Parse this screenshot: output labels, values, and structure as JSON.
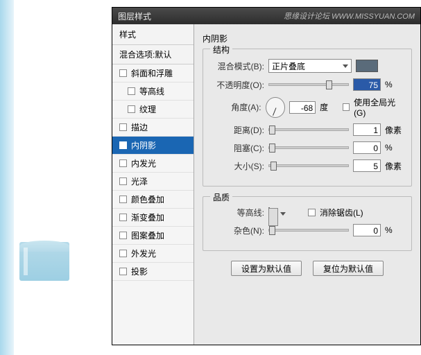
{
  "window": {
    "title": "图层样式",
    "watermark": "思缘设计论坛  WWW.MISSYUAN.COM"
  },
  "sidebar": {
    "header": "样式",
    "sub": "混合选项:默认",
    "items": [
      {
        "label": "斜面和浮雕",
        "indent": false
      },
      {
        "label": "等高线",
        "indent": true
      },
      {
        "label": "纹理",
        "indent": true
      },
      {
        "label": "描边",
        "indent": false
      },
      {
        "label": "内阴影",
        "indent": false,
        "selected": true
      },
      {
        "label": "内发光",
        "indent": false
      },
      {
        "label": "光泽",
        "indent": false
      },
      {
        "label": "颜色叠加",
        "indent": false
      },
      {
        "label": "渐变叠加",
        "indent": false
      },
      {
        "label": "图案叠加",
        "indent": false
      },
      {
        "label": "外发光",
        "indent": false
      },
      {
        "label": "投影",
        "indent": false
      }
    ]
  },
  "panel": {
    "title": "内阴影",
    "structure": {
      "legend": "结构",
      "blend_label": "混合模式(B):",
      "blend_value": "正片叠底",
      "color": "#5a6b7a",
      "opacity_label": "不透明度(O):",
      "opacity_value": "75",
      "opacity_unit": "%",
      "angle_label": "角度(A):",
      "angle_value": "-68",
      "angle_unit": "度",
      "global_light": "使用全局光(G)",
      "distance_label": "距离(D):",
      "distance_value": "1",
      "distance_unit": "像素",
      "choke_label": "阻塞(C):",
      "choke_value": "0",
      "choke_unit": "%",
      "size_label": "大小(S):",
      "size_value": "5",
      "size_unit": "像素"
    },
    "quality": {
      "legend": "品质",
      "contour_label": "等高线:",
      "antialias": "消除锯齿(L)",
      "noise_label": "杂色(N):",
      "noise_value": "0",
      "noise_unit": "%"
    },
    "buttons": {
      "default": "设置为默认值",
      "reset": "复位为默认值"
    }
  }
}
